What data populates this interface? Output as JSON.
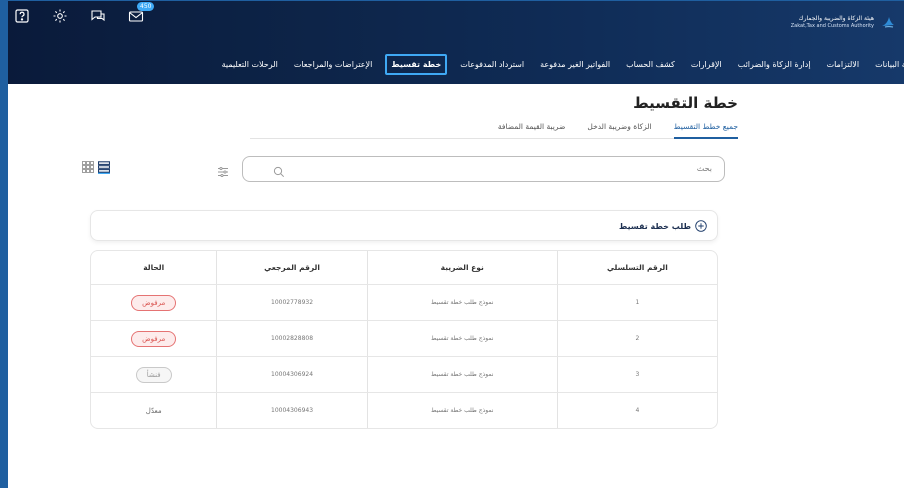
{
  "top_icons": {
    "badge_count": "450"
  },
  "brand": {
    "name_ar": "هيئة الزكاة والضريبة والجمارك",
    "name_en": "Zakat,Tax and Customs Authority"
  },
  "nav": {
    "items": [
      {
        "label": "حة البيانات"
      },
      {
        "label": "الالتزامات"
      },
      {
        "label": "إدارة الزكاة والضرائب"
      },
      {
        "label": "الإقرارات"
      },
      {
        "label": "كشف الحساب"
      },
      {
        "label": "الفواتير الغير مدفوعة"
      },
      {
        "label": "استرداد المدفوعات"
      },
      {
        "label": "خطة تقسيط"
      },
      {
        "label": "الإعتراضات والمراجعات"
      },
      {
        "label": "الرحلات التعليمية"
      }
    ]
  },
  "page": {
    "title": "خطة التقسيط"
  },
  "tabs": [
    {
      "label": "جميع خطط التقسيط"
    },
    {
      "label": "الزكاة وضريبة الدخل"
    },
    {
      "label": "ضريبة القيمة المضافة"
    }
  ],
  "search": {
    "placeholder": "بحث"
  },
  "request": {
    "label": "طلب خطة تقسيط"
  },
  "table": {
    "headers": {
      "serial": "الرقم التسلسلي",
      "tax_type": "نوع الضريبة",
      "reference": "الرقم المرجعي",
      "status": "الحالة"
    },
    "rows": [
      {
        "serial": "1",
        "tax_type": "نموذج طلب خطة تقسيط",
        "reference": "10002778932",
        "status": "مرفوض"
      },
      {
        "serial": "2",
        "tax_type": "نموذج طلب خطة تقسيط",
        "reference": "10002828808",
        "status": "مرفوض"
      },
      {
        "serial": "3",
        "tax_type": "نموذج طلب خطة تقسيط",
        "reference": "10004306924",
        "status": "فنشأ"
      },
      {
        "serial": "4",
        "tax_type": "نموذج طلب خطة تقسيط",
        "reference": "10004306943",
        "status": "معدّل"
      }
    ]
  },
  "colors": {
    "header_bg": "#0f2b55",
    "accent": "#3fa9f5",
    "primary": "#1f5fa0",
    "rejected": "#d9534f"
  }
}
